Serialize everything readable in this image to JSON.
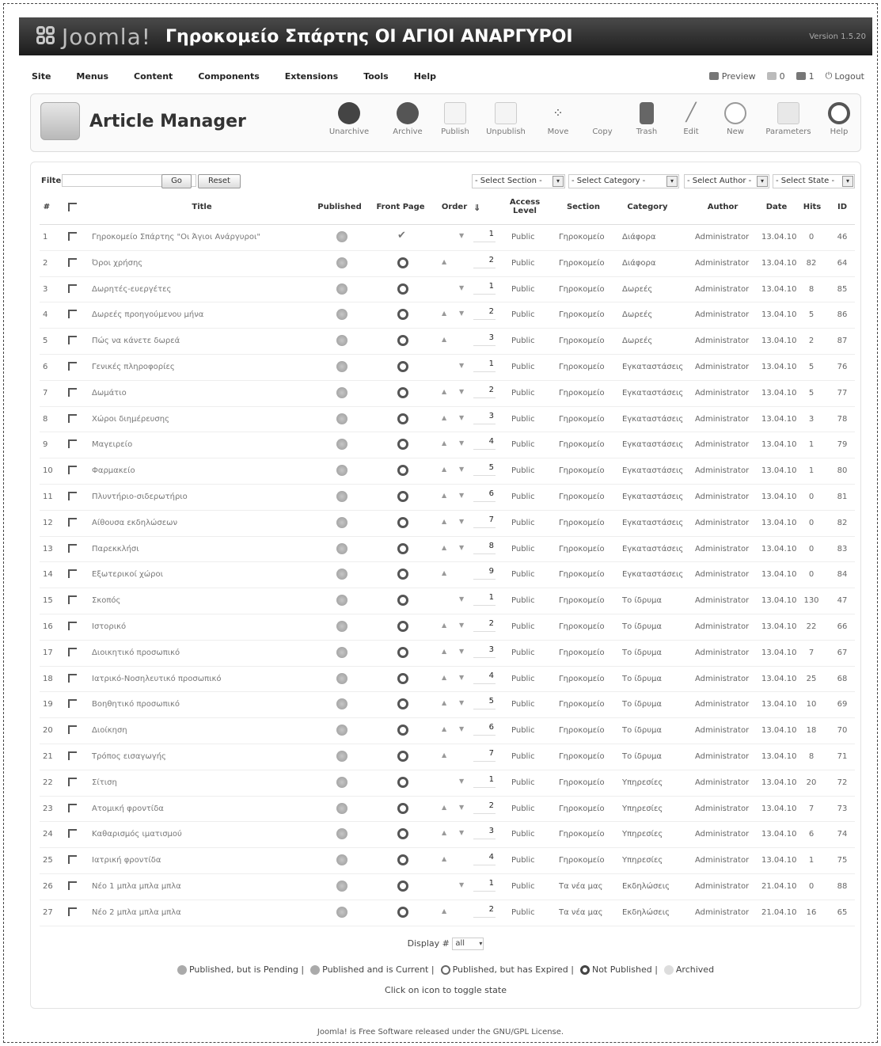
{
  "header": {
    "logo_text": "Joomla!",
    "site_name": "Γηροκομείο Σπάρτης ΟΙ ΑΓΙΟΙ ΑΝΑΡΓΥΡΟΙ",
    "version": "Version 1.5.20"
  },
  "menu": {
    "items": [
      "Site",
      "Menus",
      "Content",
      "Components",
      "Extensions",
      "Tools",
      "Help"
    ],
    "preview": "Preview",
    "messages_count": "0",
    "users_count": "1",
    "logout": "Logout"
  },
  "toolbar": {
    "title": "Article Manager",
    "buttons": [
      "Unarchive",
      "Archive",
      "Publish",
      "Unpublish",
      "Move",
      "Copy",
      "Trash",
      "Edit",
      "New",
      "Parameters",
      "Help"
    ]
  },
  "filters": {
    "filter_label": "Filter:",
    "go": "Go",
    "reset": "Reset",
    "section": "- Select Section -",
    "category": "- Select Category -",
    "author": "- Select Author -",
    "state": "- Select State -"
  },
  "table": {
    "headers": {
      "num": "#",
      "title": "Title",
      "published": "Published",
      "front_page": "Front Page",
      "order": "Order",
      "access": "Access Level",
      "section": "Section",
      "category": "Category",
      "author": "Author",
      "date": "Date",
      "hits": "Hits",
      "id": "ID"
    },
    "rows": [
      {
        "num": "1",
        "title": "Γηροκομείο Σπάρτης \"Οι Άγιοι Ανάργυροι\"",
        "front": "check",
        "up": false,
        "down": true,
        "order": "1",
        "access": "Public",
        "section": "Γηροκομείο",
        "category": "Διάφορα",
        "author": "Administrator",
        "date": "13.04.10",
        "hits": "0",
        "id": "46"
      },
      {
        "num": "2",
        "title": "Όροι χρήσης",
        "front": "no",
        "up": true,
        "down": false,
        "order": "2",
        "access": "Public",
        "section": "Γηροκομείο",
        "category": "Διάφορα",
        "author": "Administrator",
        "date": "13.04.10",
        "hits": "82",
        "id": "64"
      },
      {
        "num": "3",
        "title": "Δωρητές-ευεργέτες",
        "front": "no",
        "up": false,
        "down": true,
        "order": "1",
        "access": "Public",
        "section": "Γηροκομείο",
        "category": "Δωρεές",
        "author": "Administrator",
        "date": "13.04.10",
        "hits": "8",
        "id": "85"
      },
      {
        "num": "4",
        "title": "Δωρεές προηγούμενου μήνα",
        "front": "no",
        "up": true,
        "down": true,
        "order": "2",
        "access": "Public",
        "section": "Γηροκομείο",
        "category": "Δωρεές",
        "author": "Administrator",
        "date": "13.04.10",
        "hits": "5",
        "id": "86"
      },
      {
        "num": "5",
        "title": "Πώς να κάνετε δωρεά",
        "front": "no",
        "up": true,
        "down": false,
        "order": "3",
        "access": "Public",
        "section": "Γηροκομείο",
        "category": "Δωρεές",
        "author": "Administrator",
        "date": "13.04.10",
        "hits": "2",
        "id": "87"
      },
      {
        "num": "6",
        "title": "Γενικές πληροφορίες",
        "front": "no",
        "up": false,
        "down": true,
        "order": "1",
        "access": "Public",
        "section": "Γηροκομείο",
        "category": "Εγκαταστάσεις",
        "author": "Administrator",
        "date": "13.04.10",
        "hits": "5",
        "id": "76"
      },
      {
        "num": "7",
        "title": "Δωμάτιο",
        "front": "no",
        "up": true,
        "down": true,
        "order": "2",
        "access": "Public",
        "section": "Γηροκομείο",
        "category": "Εγκαταστάσεις",
        "author": "Administrator",
        "date": "13.04.10",
        "hits": "5",
        "id": "77"
      },
      {
        "num": "8",
        "title": "Χώροι διημέρευσης",
        "front": "no",
        "up": true,
        "down": true,
        "order": "3",
        "access": "Public",
        "section": "Γηροκομείο",
        "category": "Εγκαταστάσεις",
        "author": "Administrator",
        "date": "13.04.10",
        "hits": "3",
        "id": "78"
      },
      {
        "num": "9",
        "title": "Μαγειρείο",
        "front": "no",
        "up": true,
        "down": true,
        "order": "4",
        "access": "Public",
        "section": "Γηροκομείο",
        "category": "Εγκαταστάσεις",
        "author": "Administrator",
        "date": "13.04.10",
        "hits": "1",
        "id": "79"
      },
      {
        "num": "10",
        "title": "Φαρμακείο",
        "front": "no",
        "up": true,
        "down": true,
        "order": "5",
        "access": "Public",
        "section": "Γηροκομείο",
        "category": "Εγκαταστάσεις",
        "author": "Administrator",
        "date": "13.04.10",
        "hits": "1",
        "id": "80"
      },
      {
        "num": "11",
        "title": "Πλυντήριο-σιδερωτήριο",
        "front": "no",
        "up": true,
        "down": true,
        "order": "6",
        "access": "Public",
        "section": "Γηροκομείο",
        "category": "Εγκαταστάσεις",
        "author": "Administrator",
        "date": "13.04.10",
        "hits": "0",
        "id": "81"
      },
      {
        "num": "12",
        "title": "Αίθουσα εκδηλώσεων",
        "front": "no",
        "up": true,
        "down": true,
        "order": "7",
        "access": "Public",
        "section": "Γηροκομείο",
        "category": "Εγκαταστάσεις",
        "author": "Administrator",
        "date": "13.04.10",
        "hits": "0",
        "id": "82"
      },
      {
        "num": "13",
        "title": "Παρεκκλήσι",
        "front": "no",
        "up": true,
        "down": true,
        "order": "8",
        "access": "Public",
        "section": "Γηροκομείο",
        "category": "Εγκαταστάσεις",
        "author": "Administrator",
        "date": "13.04.10",
        "hits": "0",
        "id": "83"
      },
      {
        "num": "14",
        "title": "Εξωτερικοί χώροι",
        "front": "no",
        "up": true,
        "down": false,
        "order": "9",
        "access": "Public",
        "section": "Γηροκομείο",
        "category": "Εγκαταστάσεις",
        "author": "Administrator",
        "date": "13.04.10",
        "hits": "0",
        "id": "84"
      },
      {
        "num": "15",
        "title": "Σκοπός",
        "front": "no",
        "up": false,
        "down": true,
        "order": "1",
        "access": "Public",
        "section": "Γηροκομείο",
        "category": "Το ίδρυμα",
        "author": "Administrator",
        "date": "13.04.10",
        "hits": "130",
        "id": "47"
      },
      {
        "num": "16",
        "title": "Ιστορικό",
        "front": "no",
        "up": true,
        "down": true,
        "order": "2",
        "access": "Public",
        "section": "Γηροκομείο",
        "category": "Το ίδρυμα",
        "author": "Administrator",
        "date": "13.04.10",
        "hits": "22",
        "id": "66"
      },
      {
        "num": "17",
        "title": "Διοικητικό προσωπικό",
        "front": "no",
        "up": true,
        "down": true,
        "order": "3",
        "access": "Public",
        "section": "Γηροκομείο",
        "category": "Το ίδρυμα",
        "author": "Administrator",
        "date": "13.04.10",
        "hits": "7",
        "id": "67"
      },
      {
        "num": "18",
        "title": "Ιατρικό-Νοσηλευτικό προσωπικό",
        "front": "no",
        "up": true,
        "down": true,
        "order": "4",
        "access": "Public",
        "section": "Γηροκομείο",
        "category": "Το ίδρυμα",
        "author": "Administrator",
        "date": "13.04.10",
        "hits": "25",
        "id": "68"
      },
      {
        "num": "19",
        "title": "Βοηθητικό προσωπικό",
        "front": "no",
        "up": true,
        "down": true,
        "order": "5",
        "access": "Public",
        "section": "Γηροκομείο",
        "category": "Το ίδρυμα",
        "author": "Administrator",
        "date": "13.04.10",
        "hits": "10",
        "id": "69"
      },
      {
        "num": "20",
        "title": "Διοίκηση",
        "front": "no",
        "up": true,
        "down": true,
        "order": "6",
        "access": "Public",
        "section": "Γηροκομείο",
        "category": "Το ίδρυμα",
        "author": "Administrator",
        "date": "13.04.10",
        "hits": "18",
        "id": "70"
      },
      {
        "num": "21",
        "title": "Τρόπος εισαγωγής",
        "front": "no",
        "up": true,
        "down": false,
        "order": "7",
        "access": "Public",
        "section": "Γηροκομείο",
        "category": "Το ίδρυμα",
        "author": "Administrator",
        "date": "13.04.10",
        "hits": "8",
        "id": "71"
      },
      {
        "num": "22",
        "title": "Σίτιση",
        "front": "no",
        "up": false,
        "down": true,
        "order": "1",
        "access": "Public",
        "section": "Γηροκομείο",
        "category": "Υπηρεσίες",
        "author": "Administrator",
        "date": "13.04.10",
        "hits": "20",
        "id": "72"
      },
      {
        "num": "23",
        "title": "Ατομική φροντίδα",
        "front": "no",
        "up": true,
        "down": true,
        "order": "2",
        "access": "Public",
        "section": "Γηροκομείο",
        "category": "Υπηρεσίες",
        "author": "Administrator",
        "date": "13.04.10",
        "hits": "7",
        "id": "73"
      },
      {
        "num": "24",
        "title": "Καθαρισμός ιματισμού",
        "front": "no",
        "up": true,
        "down": true,
        "order": "3",
        "access": "Public",
        "section": "Γηροκομείο",
        "category": "Υπηρεσίες",
        "author": "Administrator",
        "date": "13.04.10",
        "hits": "6",
        "id": "74"
      },
      {
        "num": "25",
        "title": "Ιατρική φροντίδα",
        "front": "no",
        "up": true,
        "down": false,
        "order": "4",
        "access": "Public",
        "section": "Γηροκομείο",
        "category": "Υπηρεσίες",
        "author": "Administrator",
        "date": "13.04.10",
        "hits": "1",
        "id": "75"
      },
      {
        "num": "26",
        "title": "Νέο 1 μπλα μπλα μπλα",
        "front": "no",
        "up": false,
        "down": true,
        "order": "1",
        "access": "Public",
        "section": "Τα νέα μας",
        "category": "Εκδηλώσεις",
        "author": "Administrator",
        "date": "21.04.10",
        "hits": "0",
        "id": "88"
      },
      {
        "num": "27",
        "title": "Νέο 2 μπλα μπλα μπλα",
        "front": "no",
        "up": true,
        "down": false,
        "order": "2",
        "access": "Public",
        "section": "Τα νέα μας",
        "category": "Εκδηλώσεις",
        "author": "Administrator",
        "date": "21.04.10",
        "hits": "16",
        "id": "65"
      }
    ]
  },
  "footer": {
    "display_label": "Display #",
    "display_value": "all",
    "legend": [
      {
        "icon": "pending-icon",
        "text": "Published, but is Pending"
      },
      {
        "icon": "current-icon",
        "text": "Published and is Current"
      },
      {
        "icon": "expired-icon",
        "text": "Published, but has Expired"
      },
      {
        "icon": "not-published-icon",
        "text": "Not Published"
      },
      {
        "icon": "archived-icon",
        "text": "Archived"
      }
    ],
    "toggle_hint": "Click on icon to toggle state",
    "license": "Joomla! is Free Software released under the GNU/GPL License."
  }
}
